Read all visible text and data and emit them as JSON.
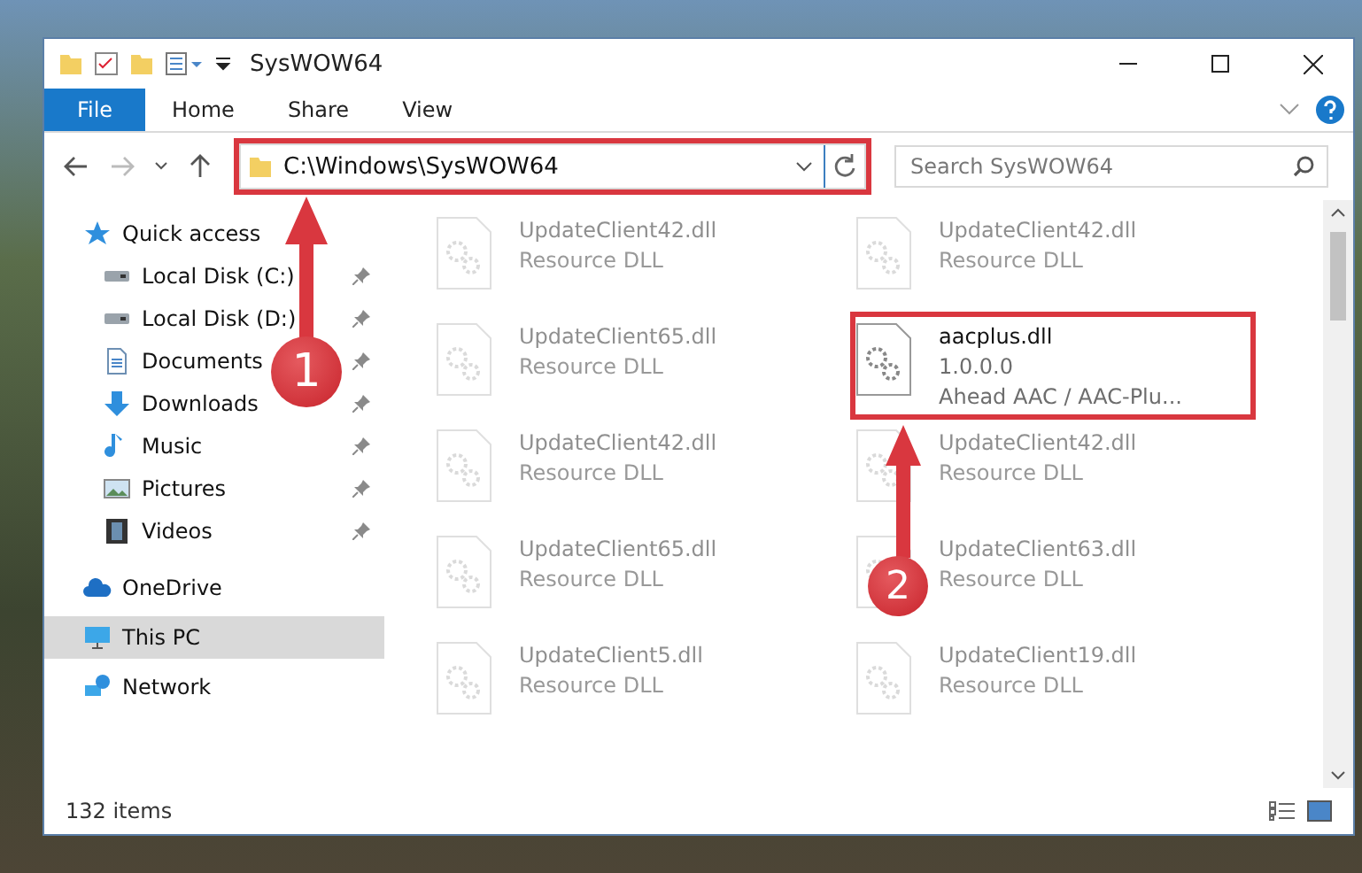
{
  "window": {
    "title": "SysWOW64"
  },
  "ribbon": {
    "tabs": [
      {
        "label": "File",
        "selected": true
      },
      {
        "label": "Home",
        "selected": false
      },
      {
        "label": "Share",
        "selected": false
      },
      {
        "label": "View",
        "selected": false
      }
    ]
  },
  "address": {
    "path": "C:\\Windows\\SysWOW64"
  },
  "search": {
    "placeholder": "Search SysWOW64"
  },
  "sidebar": {
    "items": [
      {
        "label": "Quick access",
        "selected": false,
        "children": [
          {
            "label": "Local Disk (C:)",
            "pinned": true,
            "selected": false
          },
          {
            "label": "Local Disk (D:)",
            "pinned": true,
            "selected": false
          },
          {
            "label": "Documents",
            "pinned": true,
            "selected": false
          },
          {
            "label": "Downloads",
            "pinned": true,
            "selected": false
          },
          {
            "label": "Music",
            "pinned": true,
            "selected": false
          },
          {
            "label": "Pictures",
            "pinned": true,
            "selected": false
          },
          {
            "label": "Videos",
            "pinned": true,
            "selected": false
          }
        ]
      },
      {
        "label": "OneDrive",
        "selected": false
      },
      {
        "label": "This PC",
        "selected": true
      },
      {
        "label": "Network",
        "selected": false
      }
    ]
  },
  "files": [
    {
      "name": "UpdateClient42.dll",
      "lines": [
        "Resource DLL"
      ],
      "faded": true
    },
    {
      "name": "UpdateClient42.dll",
      "lines": [
        "Resource DLL"
      ],
      "faded": true
    },
    {
      "name": "UpdateClient65.dll",
      "lines": [
        "Resource DLL"
      ],
      "faded": true
    },
    {
      "name": "aacplus.dll",
      "lines": [
        "1.0.0.0",
        "Ahead AAC / AAC-Plu..."
      ],
      "faded": false
    },
    {
      "name": "UpdateClient42.dll",
      "lines": [
        "Resource DLL"
      ],
      "faded": true
    },
    {
      "name": "UpdateClient42.dll",
      "lines": [
        "Resource DLL"
      ],
      "faded": true
    },
    {
      "name": "UpdateClient65.dll",
      "lines": [
        "Resource DLL"
      ],
      "faded": true
    },
    {
      "name": "UpdateClient63.dll",
      "lines": [
        "Resource DLL"
      ],
      "faded": true
    },
    {
      "name": "UpdateClient5.dll",
      "lines": [
        "Resource DLL"
      ],
      "faded": true
    },
    {
      "name": "UpdateClient19.dll",
      "lines": [
        "Resource DLL"
      ],
      "faded": true
    }
  ],
  "status_bar": {
    "count": "132 items"
  },
  "annotations": [
    {
      "number": "1"
    },
    {
      "number": "2"
    }
  ]
}
